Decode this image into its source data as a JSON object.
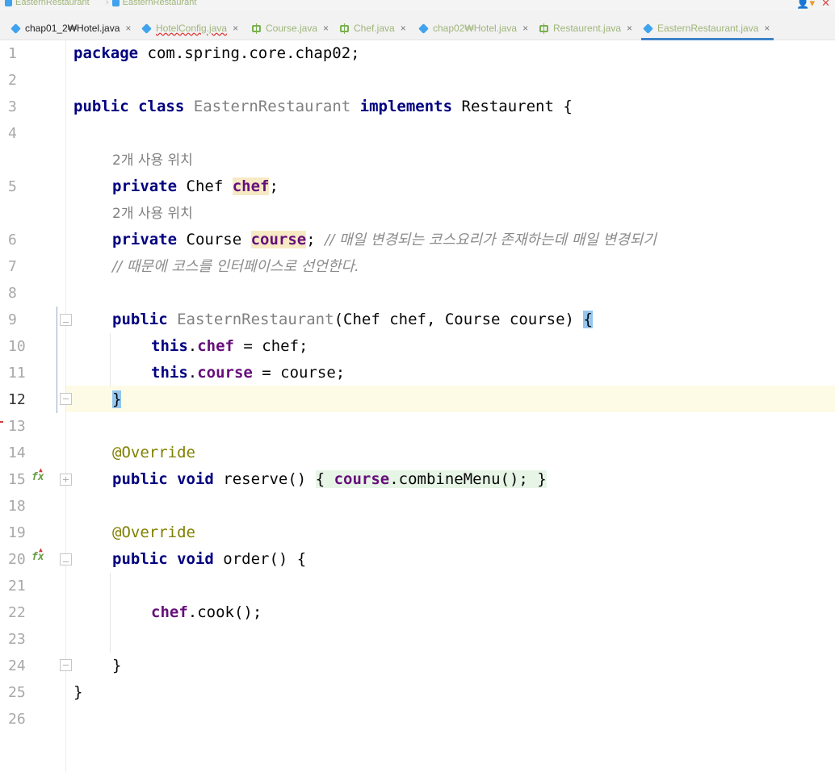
{
  "breadcrumb": {
    "items": [
      "EasternRestaurant",
      "EasternRestaurant"
    ]
  },
  "tabs": [
    {
      "label": "chap01_2₩Hotel.java",
      "icon": "java-class-icon",
      "active": false
    },
    {
      "label": "HotelConfig.java",
      "icon": "java-class-icon",
      "active": false
    },
    {
      "label": "Course.java",
      "icon": "interface-icon",
      "active": false
    },
    {
      "label": "Chef.java",
      "icon": "interface-icon",
      "active": false
    },
    {
      "label": "chap02₩Hotel.java",
      "icon": "java-class-icon",
      "active": false
    },
    {
      "label": "Restaurent.java",
      "icon": "interface-icon",
      "active": false
    },
    {
      "label": "EasternRestaurant.java",
      "icon": "java-class-icon",
      "active": true
    }
  ],
  "tab_close": "×",
  "gutter": {
    "line_numbers": [
      "1",
      "2",
      "3",
      "4",
      "5",
      "6",
      "7",
      "8",
      "9",
      "10",
      "11",
      "12",
      "13",
      "14",
      "15",
      "18",
      "19",
      "20",
      "21",
      "22",
      "23",
      "24",
      "25",
      "26"
    ],
    "current_line": "12",
    "override_marker": "fx"
  },
  "code": {
    "l1_kw": "package",
    "l1_rest": " com.spring.core.chap02;",
    "l3_kw1": "public",
    "l3_kw2": "class",
    "l3_cls": "EasternRestaurant",
    "l3_kw3": "implements",
    "l3_rest": " Restaurent {",
    "hint_usages_1": "2개 사용 위치",
    "l5_kw": "private",
    "l5_type": " Chef ",
    "l5_field": "chef",
    "l5_end": ";",
    "hint_usages_2": "2개 사용 위치",
    "l6_kw": "private",
    "l6_type": " Course ",
    "l6_field": "course",
    "l6_end": "; ",
    "l6_comment": "// 매일 변경되는 코스요리가 존재하는데 매일 변경되기",
    "l7_comment": "// 때문에 코스를 인터페이스로 선언한다.",
    "l9_kw": "public",
    "l9_cls": "EasternRestaurant",
    "l9_params": "(Chef chef, Course course) ",
    "l9_brace": "{",
    "l10_kw": "this",
    "l10_dot": ".",
    "l10_field": "chef",
    "l10_rest": " = chef;",
    "l11_kw": "this",
    "l11_dot": ".",
    "l11_field": "course",
    "l11_rest": " = course;",
    "l12_brace": "}",
    "l14_ann": "@Override",
    "l15_kw1": "public",
    "l15_kw2": "void",
    "l15_name": " reserve() ",
    "l15_open": "{ ",
    "l15_field": "course",
    "l15_call": ".combineMenu(); ",
    "l15_close": "}",
    "l19_ann": "@Override",
    "l20_kw1": "public",
    "l20_kw2": "void",
    "l20_rest": " order() {",
    "l22_field": "chef",
    "l22_rest": ".cook();",
    "l24_brace": "}",
    "l25_brace": "}"
  },
  "colors": {
    "keyword": "#000080",
    "field": "#660e7a",
    "annotation": "#808000",
    "comment": "#8c8c8c",
    "current_line_bg": "#fdfbe6",
    "active_tab_underline": "#4083c9"
  }
}
